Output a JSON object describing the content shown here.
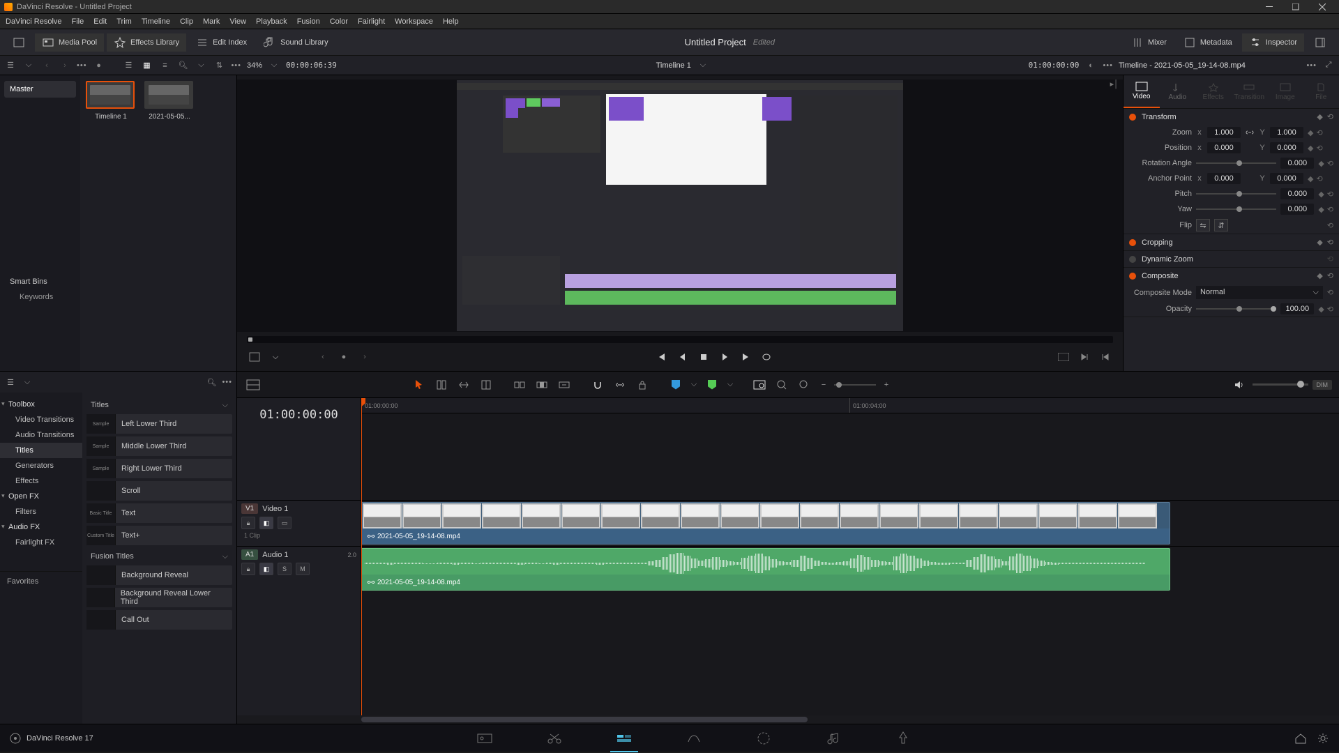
{
  "titlebar": {
    "text": "DaVinci Resolve - Untitled Project"
  },
  "menu": [
    "DaVinci Resolve",
    "File",
    "Edit",
    "Trim",
    "Timeline",
    "Clip",
    "Mark",
    "View",
    "Playback",
    "Fusion",
    "Color",
    "Fairlight",
    "Workspace",
    "Help"
  ],
  "toolbar": {
    "media_pool": "Media Pool",
    "effects_library": "Effects Library",
    "edit_index": "Edit Index",
    "sound_library": "Sound Library",
    "mixer": "Mixer",
    "metadata": "Metadata",
    "inspector": "Inspector"
  },
  "project": {
    "title": "Untitled Project",
    "status": "Edited"
  },
  "secbar": {
    "zoom": "34%",
    "tc_left": "00:00:06:39",
    "timeline_name": "Timeline 1",
    "tc_right": "01:00:00:00",
    "inspector_title": "Timeline - 2021-05-05_19-14-08.mp4"
  },
  "media_pool": {
    "master": "Master",
    "smart_bins": "Smart Bins",
    "keywords": "Keywords",
    "thumbs": [
      {
        "name": "Timeline 1",
        "selected": true
      },
      {
        "name": "2021-05-05...",
        "selected": false
      }
    ]
  },
  "inspector": {
    "tabs": [
      "Video",
      "Audio",
      "Effects",
      "Transition",
      "Image",
      "File"
    ],
    "transform": {
      "title": "Transform",
      "zoom_label": "Zoom",
      "zoom_x": "1.000",
      "zoom_y": "1.000",
      "position_label": "Position",
      "pos_x": "0.000",
      "pos_y": "0.000",
      "rotation_label": "Rotation Angle",
      "rotation": "0.000",
      "anchor_label": "Anchor Point",
      "anchor_x": "0.000",
      "anchor_y": "0.000",
      "pitch_label": "Pitch",
      "pitch": "0.000",
      "yaw_label": "Yaw",
      "yaw": "0.000",
      "flip_label": "Flip"
    },
    "cropping": "Cropping",
    "dynamic_zoom": "Dynamic Zoom",
    "composite": {
      "title": "Composite",
      "mode_label": "Composite Mode",
      "mode": "Normal",
      "opacity_label": "Opacity",
      "opacity": "100.00"
    }
  },
  "fx": {
    "tree": [
      {
        "label": "Toolbox",
        "group": true
      },
      {
        "label": "Video Transitions"
      },
      {
        "label": "Audio Transitions"
      },
      {
        "label": "Titles",
        "selected": true
      },
      {
        "label": "Generators"
      },
      {
        "label": "Effects"
      },
      {
        "label": "Open FX",
        "group": true
      },
      {
        "label": "Filters"
      },
      {
        "label": "Audio FX",
        "group": true
      },
      {
        "label": "Fairlight FX"
      }
    ],
    "favorites": "Favorites",
    "cat_titles": "Titles",
    "titles_items": [
      "Left Lower Third",
      "Middle Lower Third",
      "Right Lower Third",
      "Scroll",
      "Text",
      "Text+"
    ],
    "titles_thumbs": [
      "Sample",
      "Sample",
      "Sample",
      "",
      "Basic Title",
      "Custom Title"
    ],
    "cat_fusion": "Fusion Titles",
    "fusion_items": [
      "Background Reveal",
      "Background Reveal Lower Third",
      "Call Out"
    ]
  },
  "timeline": {
    "tc": "01:00:00:00",
    "ruler": [
      "01:00:00:00",
      "01:00:04:00"
    ],
    "video_track": {
      "badge": "V1",
      "name": "Video 1",
      "clips": "1 Clip"
    },
    "audio_track": {
      "badge": "A1",
      "name": "Audio 1",
      "val": "2.0",
      "s": "S",
      "m": "M"
    },
    "clip_name": "2021-05-05_19-14-08.mp4",
    "dim": "DIM"
  },
  "bottom": {
    "version": "DaVinci Resolve 17"
  }
}
